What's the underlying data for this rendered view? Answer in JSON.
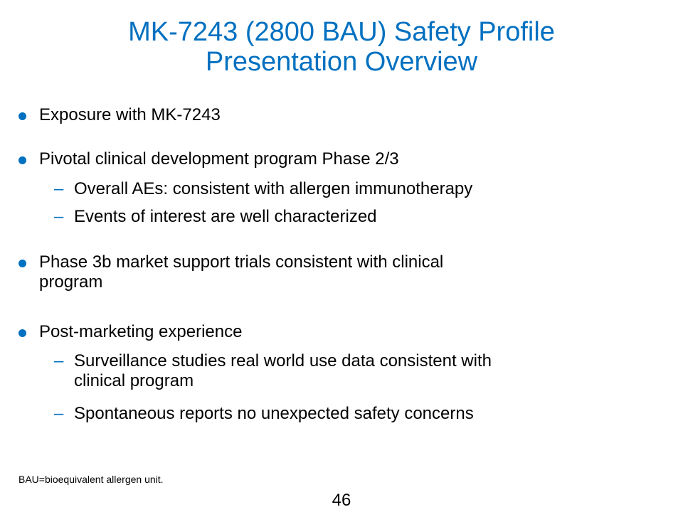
{
  "title": {
    "line1": "MK-7243 (2800 BAU) Safety Profile",
    "line2": "Presentation Overview"
  },
  "bullets": [
    {
      "text": "Exposure with MK-7243"
    },
    {
      "text": "Pivotal clinical development program Phase 2/3",
      "subs": [
        "Overall AEs: consistent with allergen immunotherapy",
        "Events of interest are well characterized"
      ]
    },
    {
      "text_line1": "Phase 3b market support trials consistent with clinical",
      "text_line2": "program"
    },
    {
      "text": "Post-marketing experience",
      "subs": [
        {
          "line1": "Surveillance studies real world use data consistent with",
          "line2": "clinical program"
        },
        "Spontaneous reports no unexpected safety concerns"
      ]
    }
  ],
  "dash_glyph": "–",
  "footnote": "BAU=bioequivalent allergen unit.",
  "page_number": "46",
  "colors": {
    "accent": "#0070c0",
    "text": "#000000",
    "background": "#ffffff"
  }
}
